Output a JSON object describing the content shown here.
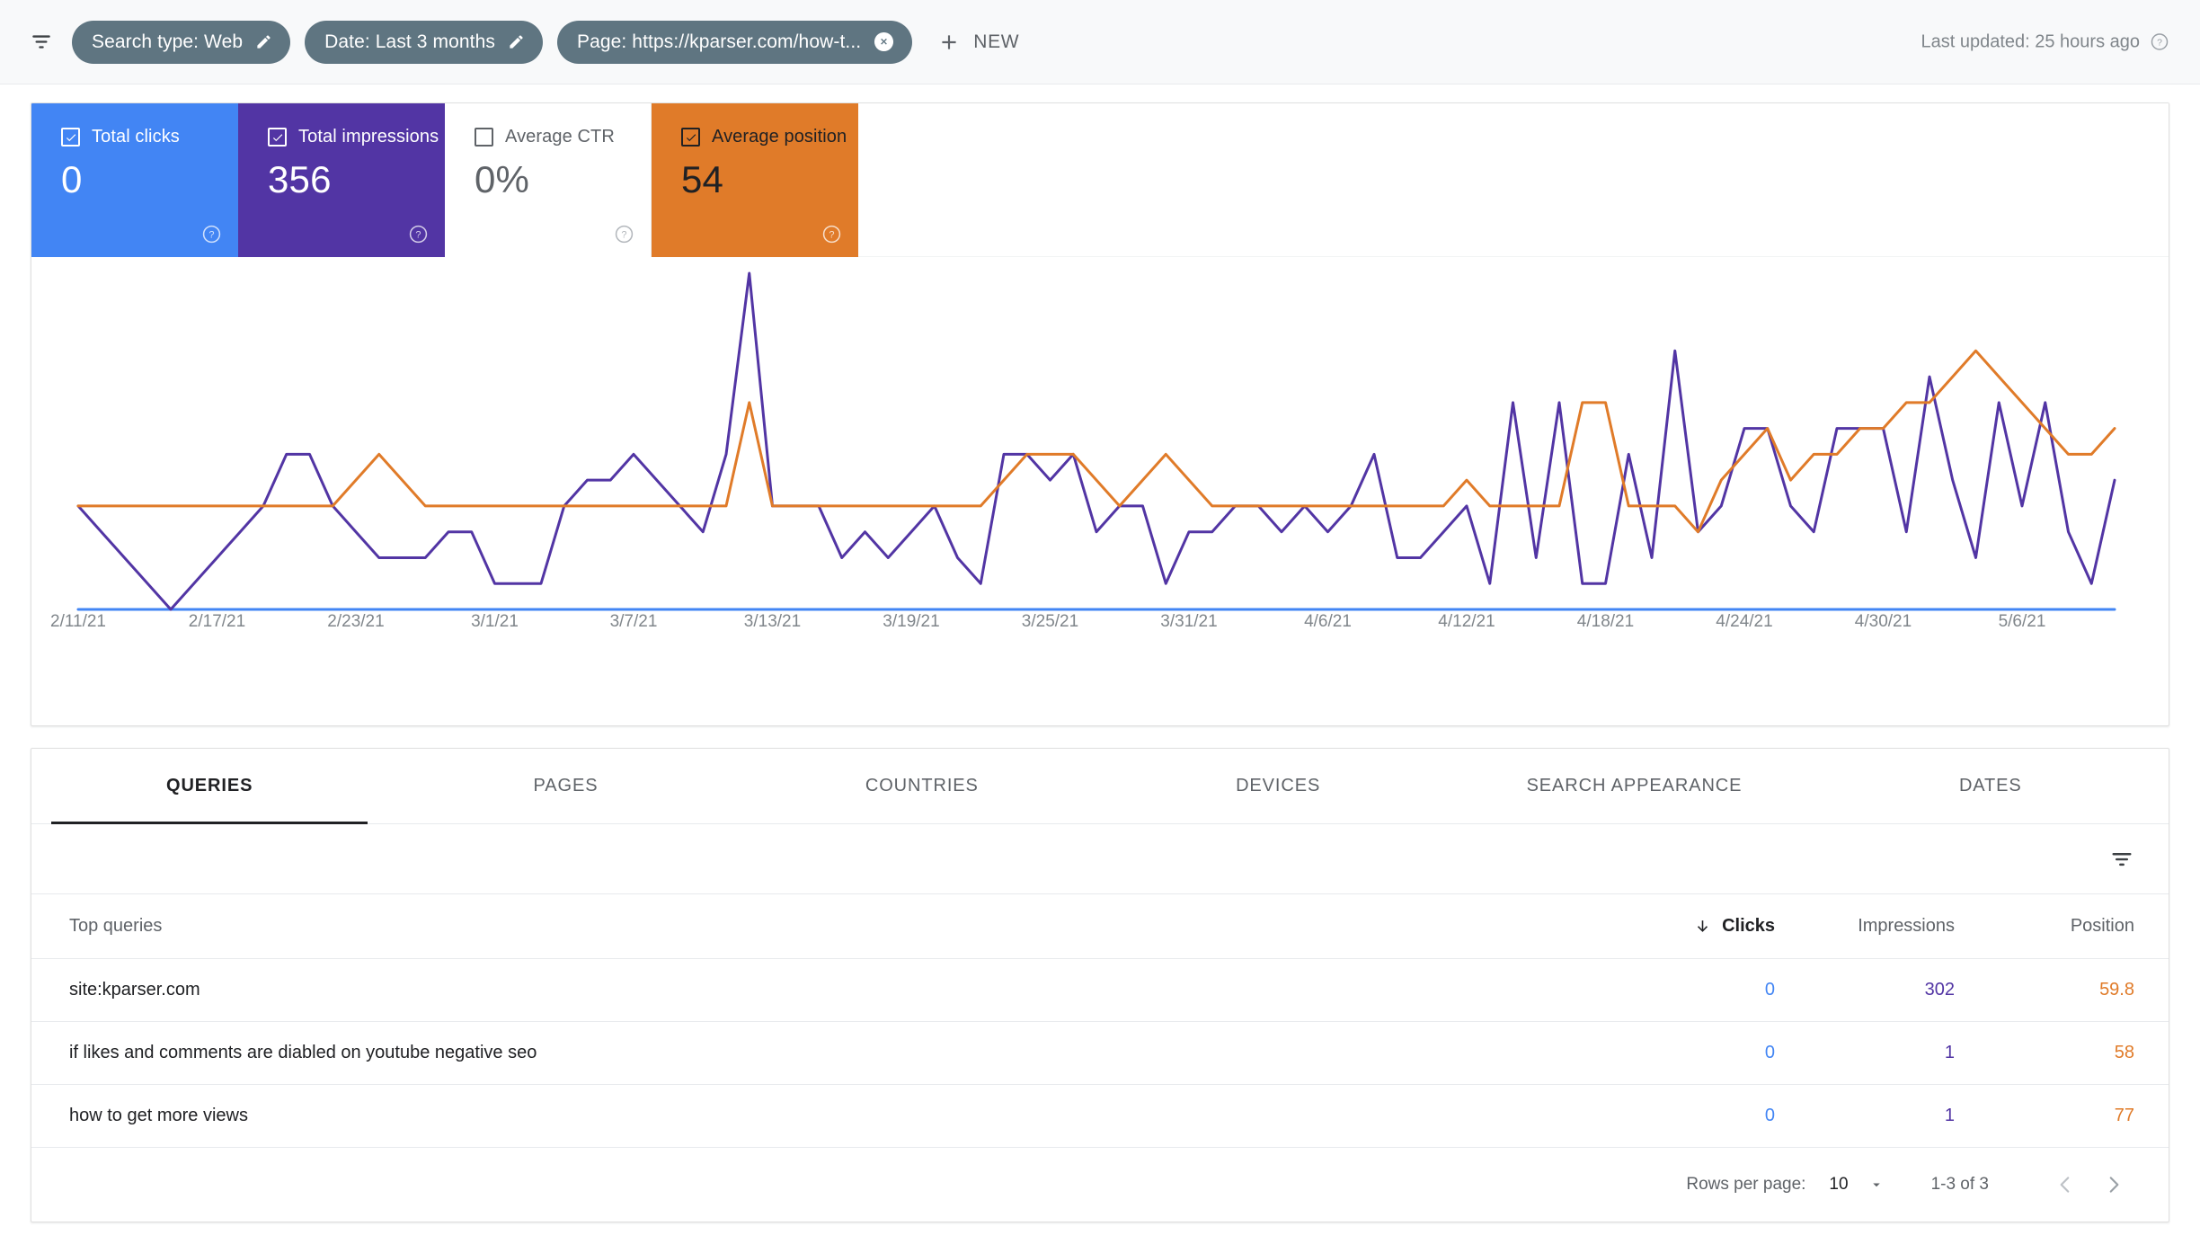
{
  "topbar": {
    "filter_icon": "filter-lines-icon",
    "chips": [
      {
        "label": "Search type: Web",
        "action_icon": "pencil-icon",
        "action": "edit"
      },
      {
        "label": "Date: Last 3 months",
        "action_icon": "pencil-icon",
        "action": "edit"
      },
      {
        "label": "Page: https://kparser.com/how-t...",
        "action_icon": "close-circle-icon",
        "action": "remove"
      }
    ],
    "new_button": {
      "label": "NEW",
      "icon": "plus-icon"
    },
    "last_updated": "Last updated: 25 hours ago",
    "last_updated_help_icon": "help-circle-icon"
  },
  "metrics": [
    {
      "label": "Total clicks",
      "value": "0",
      "checked": true,
      "color": "#4285f4",
      "text_color": "#ffffff"
    },
    {
      "label": "Total impressions",
      "value": "356",
      "checked": true,
      "color": "#5235a4",
      "text_color": "#ffffff"
    },
    {
      "label": "Average CTR",
      "value": "0%",
      "checked": false,
      "color": "#ffffff",
      "text_color": "#5f6368"
    },
    {
      "label": "Average position",
      "value": "54",
      "checked": true,
      "color": "#e07b29",
      "text_color": "#202124"
    }
  ],
  "chart_data": {
    "type": "line",
    "title": "",
    "xlabel": "",
    "ylabel": "",
    "grid": false,
    "legend": "none",
    "x_ticks": [
      "2/11/21",
      "2/17/21",
      "2/23/21",
      "3/1/21",
      "3/7/21",
      "3/13/21",
      "3/19/21",
      "3/25/21",
      "3/31/21",
      "4/6/21",
      "4/12/21",
      "4/18/21",
      "4/24/21",
      "4/30/21",
      "5/6/21"
    ],
    "x_tick_index": [
      0,
      6,
      12,
      18,
      24,
      30,
      36,
      42,
      48,
      54,
      60,
      66,
      72,
      78,
      84
    ],
    "series": [
      {
        "name": "Total clicks",
        "color": "#4285f4",
        "values": [
          0,
          0,
          0,
          0,
          0,
          0,
          0,
          0,
          0,
          0,
          0,
          0,
          0,
          0,
          0,
          0,
          0,
          0,
          0,
          0,
          0,
          0,
          0,
          0,
          0,
          0,
          0,
          0,
          0,
          0,
          0,
          0,
          0,
          0,
          0,
          0,
          0,
          0,
          0,
          0,
          0,
          0,
          0,
          0,
          0,
          0,
          0,
          0,
          0,
          0,
          0,
          0,
          0,
          0,
          0,
          0,
          0,
          0,
          0,
          0,
          0,
          0,
          0,
          0,
          0,
          0,
          0,
          0,
          0,
          0,
          0,
          0,
          0,
          0,
          0,
          0,
          0,
          0,
          0,
          0,
          0,
          0,
          0,
          0,
          0,
          0,
          0,
          0,
          0
        ]
      },
      {
        "name": "Total impressions",
        "color": "#5235a4",
        "values": [
          4,
          3,
          2,
          1,
          0,
          1,
          2,
          3,
          4,
          6,
          6,
          4,
          3,
          2,
          2,
          2,
          3,
          3,
          1,
          1,
          1,
          4,
          5,
          5,
          6,
          5,
          4,
          3,
          6,
          13,
          4,
          4,
          4,
          2,
          3,
          2,
          3,
          4,
          2,
          1,
          6,
          6,
          5,
          6,
          3,
          4,
          4,
          1,
          3,
          3,
          4,
          4,
          3,
          4,
          3,
          4,
          6,
          2,
          2,
          3,
          4,
          1,
          8,
          2,
          8,
          1,
          1,
          6,
          2,
          10,
          3,
          4,
          7,
          7,
          4,
          3,
          7,
          7,
          7,
          3,
          9,
          5,
          2,
          8,
          4,
          8,
          3,
          1,
          5
        ]
      },
      {
        "name": "Average position",
        "color": "#e07b29",
        "values": [
          4,
          4,
          4,
          4,
          4,
          4,
          4,
          4,
          4,
          4,
          4,
          4,
          5,
          6,
          5,
          4,
          4,
          4,
          4,
          4,
          4,
          4,
          4,
          4,
          4,
          4,
          4,
          4,
          4,
          8,
          4,
          4,
          4,
          4,
          4,
          4,
          4,
          4,
          4,
          4,
          5,
          6,
          6,
          6,
          5,
          4,
          5,
          6,
          5,
          4,
          4,
          4,
          4,
          4,
          4,
          4,
          4,
          4,
          4,
          4,
          5,
          4,
          4,
          4,
          4,
          8,
          8,
          4,
          4,
          4,
          3,
          5,
          6,
          7,
          5,
          6,
          6,
          7,
          7,
          8,
          8,
          9,
          10,
          9,
          8,
          7,
          6,
          6,
          7
        ]
      }
    ]
  },
  "tabs": [
    {
      "label": "QUERIES",
      "active": true
    },
    {
      "label": "PAGES",
      "active": false
    },
    {
      "label": "COUNTRIES",
      "active": false
    },
    {
      "label": "DEVICES",
      "active": false
    },
    {
      "label": "SEARCH APPEARANCE",
      "active": false
    },
    {
      "label": "DATES",
      "active": false
    }
  ],
  "table_tools": {
    "filter_icon": "filter-list-icon"
  },
  "table": {
    "columns": {
      "query": "Top queries",
      "clicks": "Clicks",
      "impressions": "Impressions",
      "position": "Position"
    },
    "sort": {
      "column": "clicks",
      "direction": "desc",
      "icon": "arrow-down-icon"
    },
    "rows": [
      {
        "query": "site:kparser.com",
        "clicks": "0",
        "impressions": "302",
        "position": "59.8"
      },
      {
        "query": "if likes and comments are diabled on youtube negative seo",
        "clicks": "0",
        "impressions": "1",
        "position": "58"
      },
      {
        "query": "how to get more views",
        "clicks": "0",
        "impressions": "1",
        "position": "77"
      }
    ]
  },
  "pagination": {
    "rows_per_page_label": "Rows per page:",
    "rows_per_page_value": "10",
    "caret_icon": "chevron-down-icon",
    "range": "1-3 of 3",
    "prev_icon": "chevron-left-icon",
    "next_icon": "chevron-right-icon"
  }
}
